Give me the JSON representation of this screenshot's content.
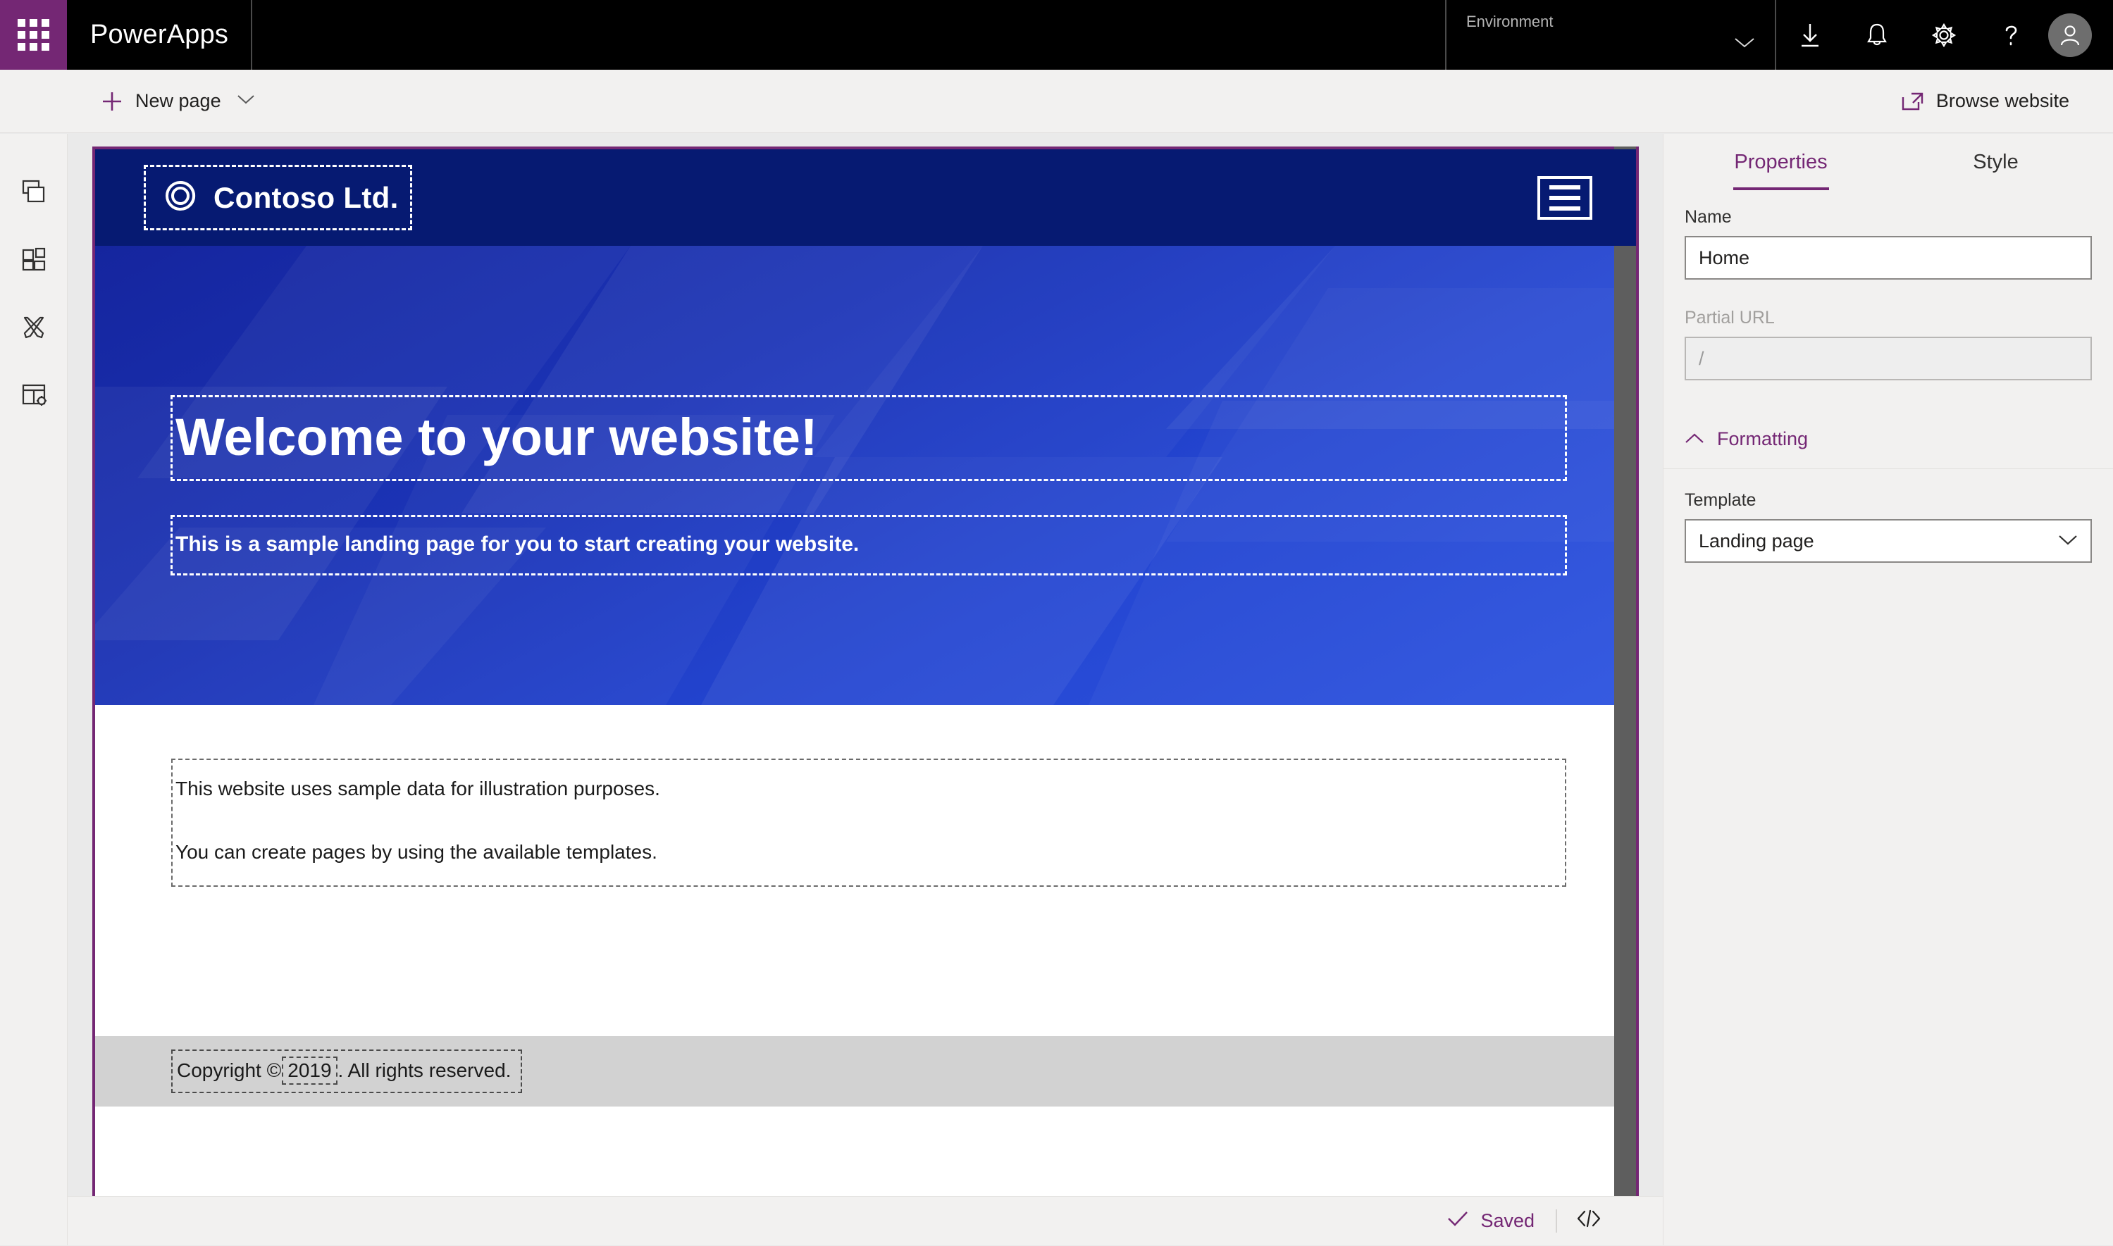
{
  "suite": {
    "waffle_icon": "app-launcher-waffle-icon",
    "brand": "PowerApps",
    "environment": {
      "label": "Environment",
      "chevron": "chevron-down-icon"
    },
    "icons": [
      {
        "name": "download-icon"
      },
      {
        "name": "notification-bell-icon"
      },
      {
        "name": "settings-gear-icon"
      },
      {
        "name": "help-question-icon"
      },
      {
        "name": "user-avatar"
      }
    ]
  },
  "command_bar": {
    "new_page_label": "New page",
    "new_page_icon": "plus-icon",
    "new_page_chevron": "chevron-down-icon",
    "browse_website_label": "Browse website",
    "browse_website_icon": "external-link-icon"
  },
  "left_rail": [
    {
      "name": "sidebar-item-pages",
      "icon": "pages-stack-icon"
    },
    {
      "name": "sidebar-item-components",
      "icon": "components-grid-icon"
    },
    {
      "name": "sidebar-item-theme",
      "icon": "pencil-ruler-icon"
    },
    {
      "name": "sidebar-item-site-settings",
      "icon": "table-gear-icon"
    }
  ],
  "canvas": {
    "site_header": {
      "logo_mark": "contoso-ring-logo-icon",
      "logo_text": "Contoso Ltd.",
      "menu_icon": "hamburger-menu-icon"
    },
    "hero": {
      "title": "Welcome to your website!",
      "subtitle": "This is a sample landing page for you to start creating your website."
    },
    "body": {
      "paragraphs": [
        "This website uses sample data for illustration purposes.",
        "You can create pages by using the available templates."
      ]
    },
    "footer": {
      "prefix": "Copyright ©",
      "year": "2019",
      "suffix": ". All rights reserved."
    }
  },
  "right_panel": {
    "tabs": [
      {
        "label": "Properties",
        "active": true
      },
      {
        "label": "Style",
        "active": false
      }
    ],
    "name_field": {
      "label": "Name",
      "value": "Home"
    },
    "partial_url_field": {
      "label": "Partial URL",
      "value": "/",
      "disabled": true
    },
    "formatting_section": {
      "label": "Formatting",
      "chevron": "chevron-up-icon"
    },
    "template_field": {
      "label": "Template",
      "value": "Landing page",
      "chevron": "chevron-down-icon"
    }
  },
  "status_bar": {
    "saved_label": "Saved",
    "saved_icon": "checkmark-icon",
    "code_icon": "code-brackets-icon"
  },
  "colors": {
    "brand_purple": "#742774",
    "suite_black": "#000000",
    "site_header_navy": "#061a72",
    "hero_blue_start": "#15259e",
    "hero_blue_end": "#2f55e0",
    "footer_grey": "#d2d2d2"
  }
}
